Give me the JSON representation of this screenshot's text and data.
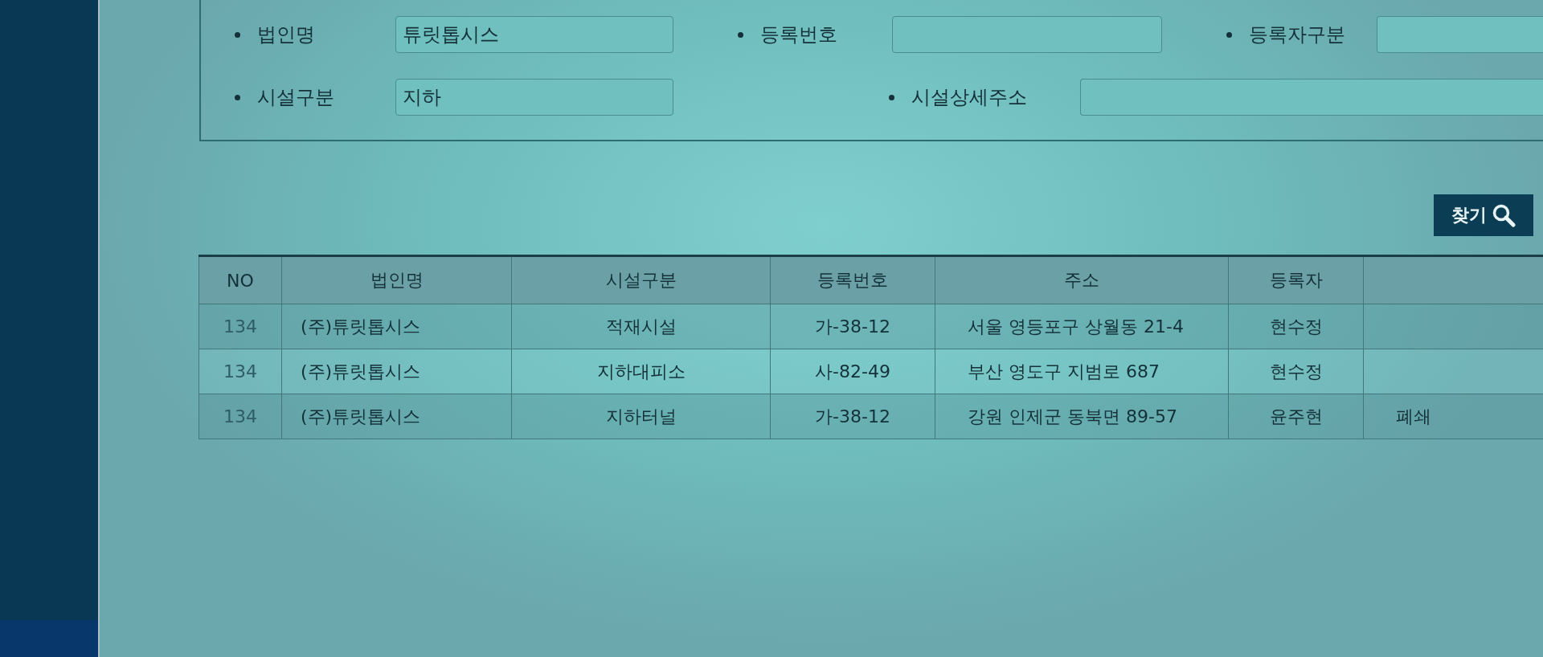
{
  "search_form": {
    "rows": [
      [
        {
          "label": "법인명",
          "value": "튜릿톱시스"
        },
        {
          "label": "등록번호"
        },
        {
          "label": "등록자구분"
        }
      ],
      [
        {
          "label": "시설구분",
          "value": "지하"
        },
        {
          "label": "시설상세주소"
        }
      ]
    ]
  },
  "search_button": {
    "label": "찾기"
  },
  "table": {
    "columns": [
      "NO",
      "법인명",
      "시설구분",
      "등록번호",
      "주소",
      "등록자"
    ],
    "rows": [
      [
        "134",
        "(주)튜릿톱시스",
        "적재시설",
        "가-38-12",
        "서울 영등포구 상월동 21-4",
        "현수정"
      ],
      [
        "134",
        "(주)튜릿톱시스",
        "지하대피소",
        "사-82-49",
        "부산 영도구 지범로 687",
        "현수정"
      ],
      [
        "134",
        "(주)튜릿톱시스",
        "지하터널",
        "가-38-12",
        "강원 인제군 동북면 89-57",
        "윤주현",
        "폐쇄"
      ]
    ]
  }
}
